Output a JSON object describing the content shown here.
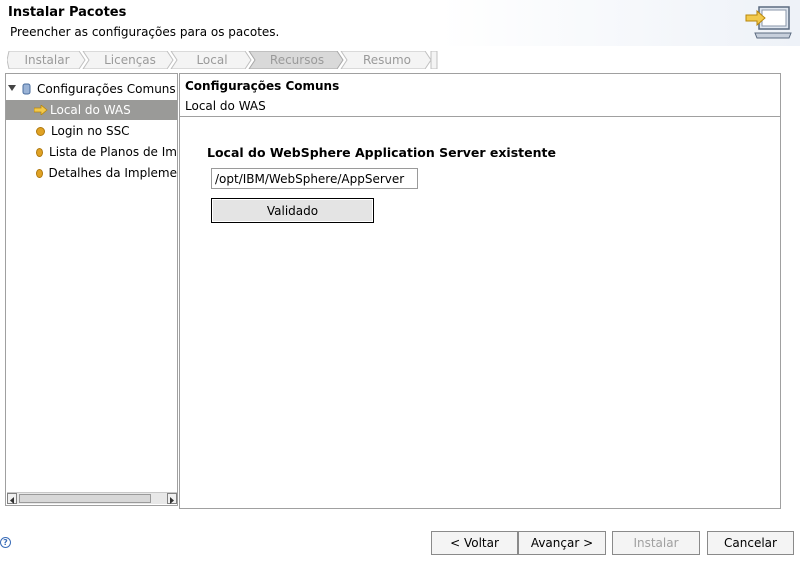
{
  "header": {
    "title": "Instalar Pacotes",
    "subtitle": "Preencher as configurações para os pacotes."
  },
  "steps": [
    {
      "label": "Instalar",
      "active": false
    },
    {
      "label": "Licenças",
      "active": false
    },
    {
      "label": "Local",
      "active": false
    },
    {
      "label": "Recursos",
      "active": true
    },
    {
      "label": "Resumo",
      "active": false
    }
  ],
  "tree": {
    "root": "Configurações Comuns",
    "items": [
      {
        "label": "Local do WAS",
        "selected": true,
        "icon": "arrow-icon"
      },
      {
        "label": "Login no SSC",
        "selected": false,
        "icon": "dot-icon"
      },
      {
        "label": "Lista de Planos de Im",
        "selected": false,
        "icon": "dot-icon"
      },
      {
        "label": "Detalhes da Impleme",
        "selected": false,
        "icon": "dot-icon"
      }
    ]
  },
  "panel": {
    "title": "Configurações Comuns",
    "subtitle": "Local do WAS",
    "section_label": "Local do WebSphere Application Server existente",
    "path_value": "/opt/IBM/WebSphere/AppServer",
    "validate_label": "Validado"
  },
  "footer": {
    "back_label": "< Voltar",
    "next_label": "Avançar >",
    "install_label": "Instalar",
    "cancel_label": "Cancelar"
  },
  "colors": {
    "selected_row": "#9a9a98",
    "accent_orange": "#e0a224",
    "step_active_bg": "#d9d9d9"
  }
}
